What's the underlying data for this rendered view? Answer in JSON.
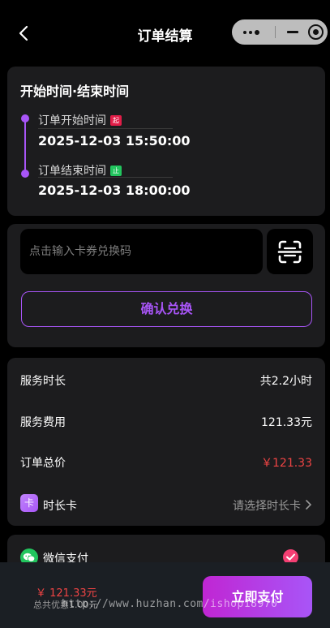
{
  "nav": {
    "title": "订单结算"
  },
  "time_card": {
    "title": "开始时间·结束时间",
    "start_label": "订单开始时间",
    "start_tag": "起",
    "start_value": "2025-12-03 15:50:00",
    "end_label": "订单结束时间",
    "end_tag": "止",
    "end_value": "2025-12-03 18:00:00"
  },
  "coupon": {
    "placeholder": "点击输入卡券兑换码",
    "confirm_label": "确认兑换"
  },
  "summary": {
    "duration_label": "服务时长",
    "duration_value": "共2.2小时",
    "fee_label": "服务费用",
    "fee_value": "121.33元",
    "total_label": "订单总价",
    "total_value": "￥121.33",
    "card_icon": "卡",
    "card_label": "时长卡",
    "card_value": "请选择时长卡"
  },
  "payment": {
    "method_label": "微信支付"
  },
  "bottom": {
    "price": "￥ 121.33元",
    "discount": "总共优惠1.00元",
    "pay_label": "立即支付",
    "watermark": "http://www.huzhan.com/ishop18970"
  },
  "colors": {
    "accent": "#a855f7",
    "price": "#ef4444",
    "wechat": "#22c55e"
  }
}
